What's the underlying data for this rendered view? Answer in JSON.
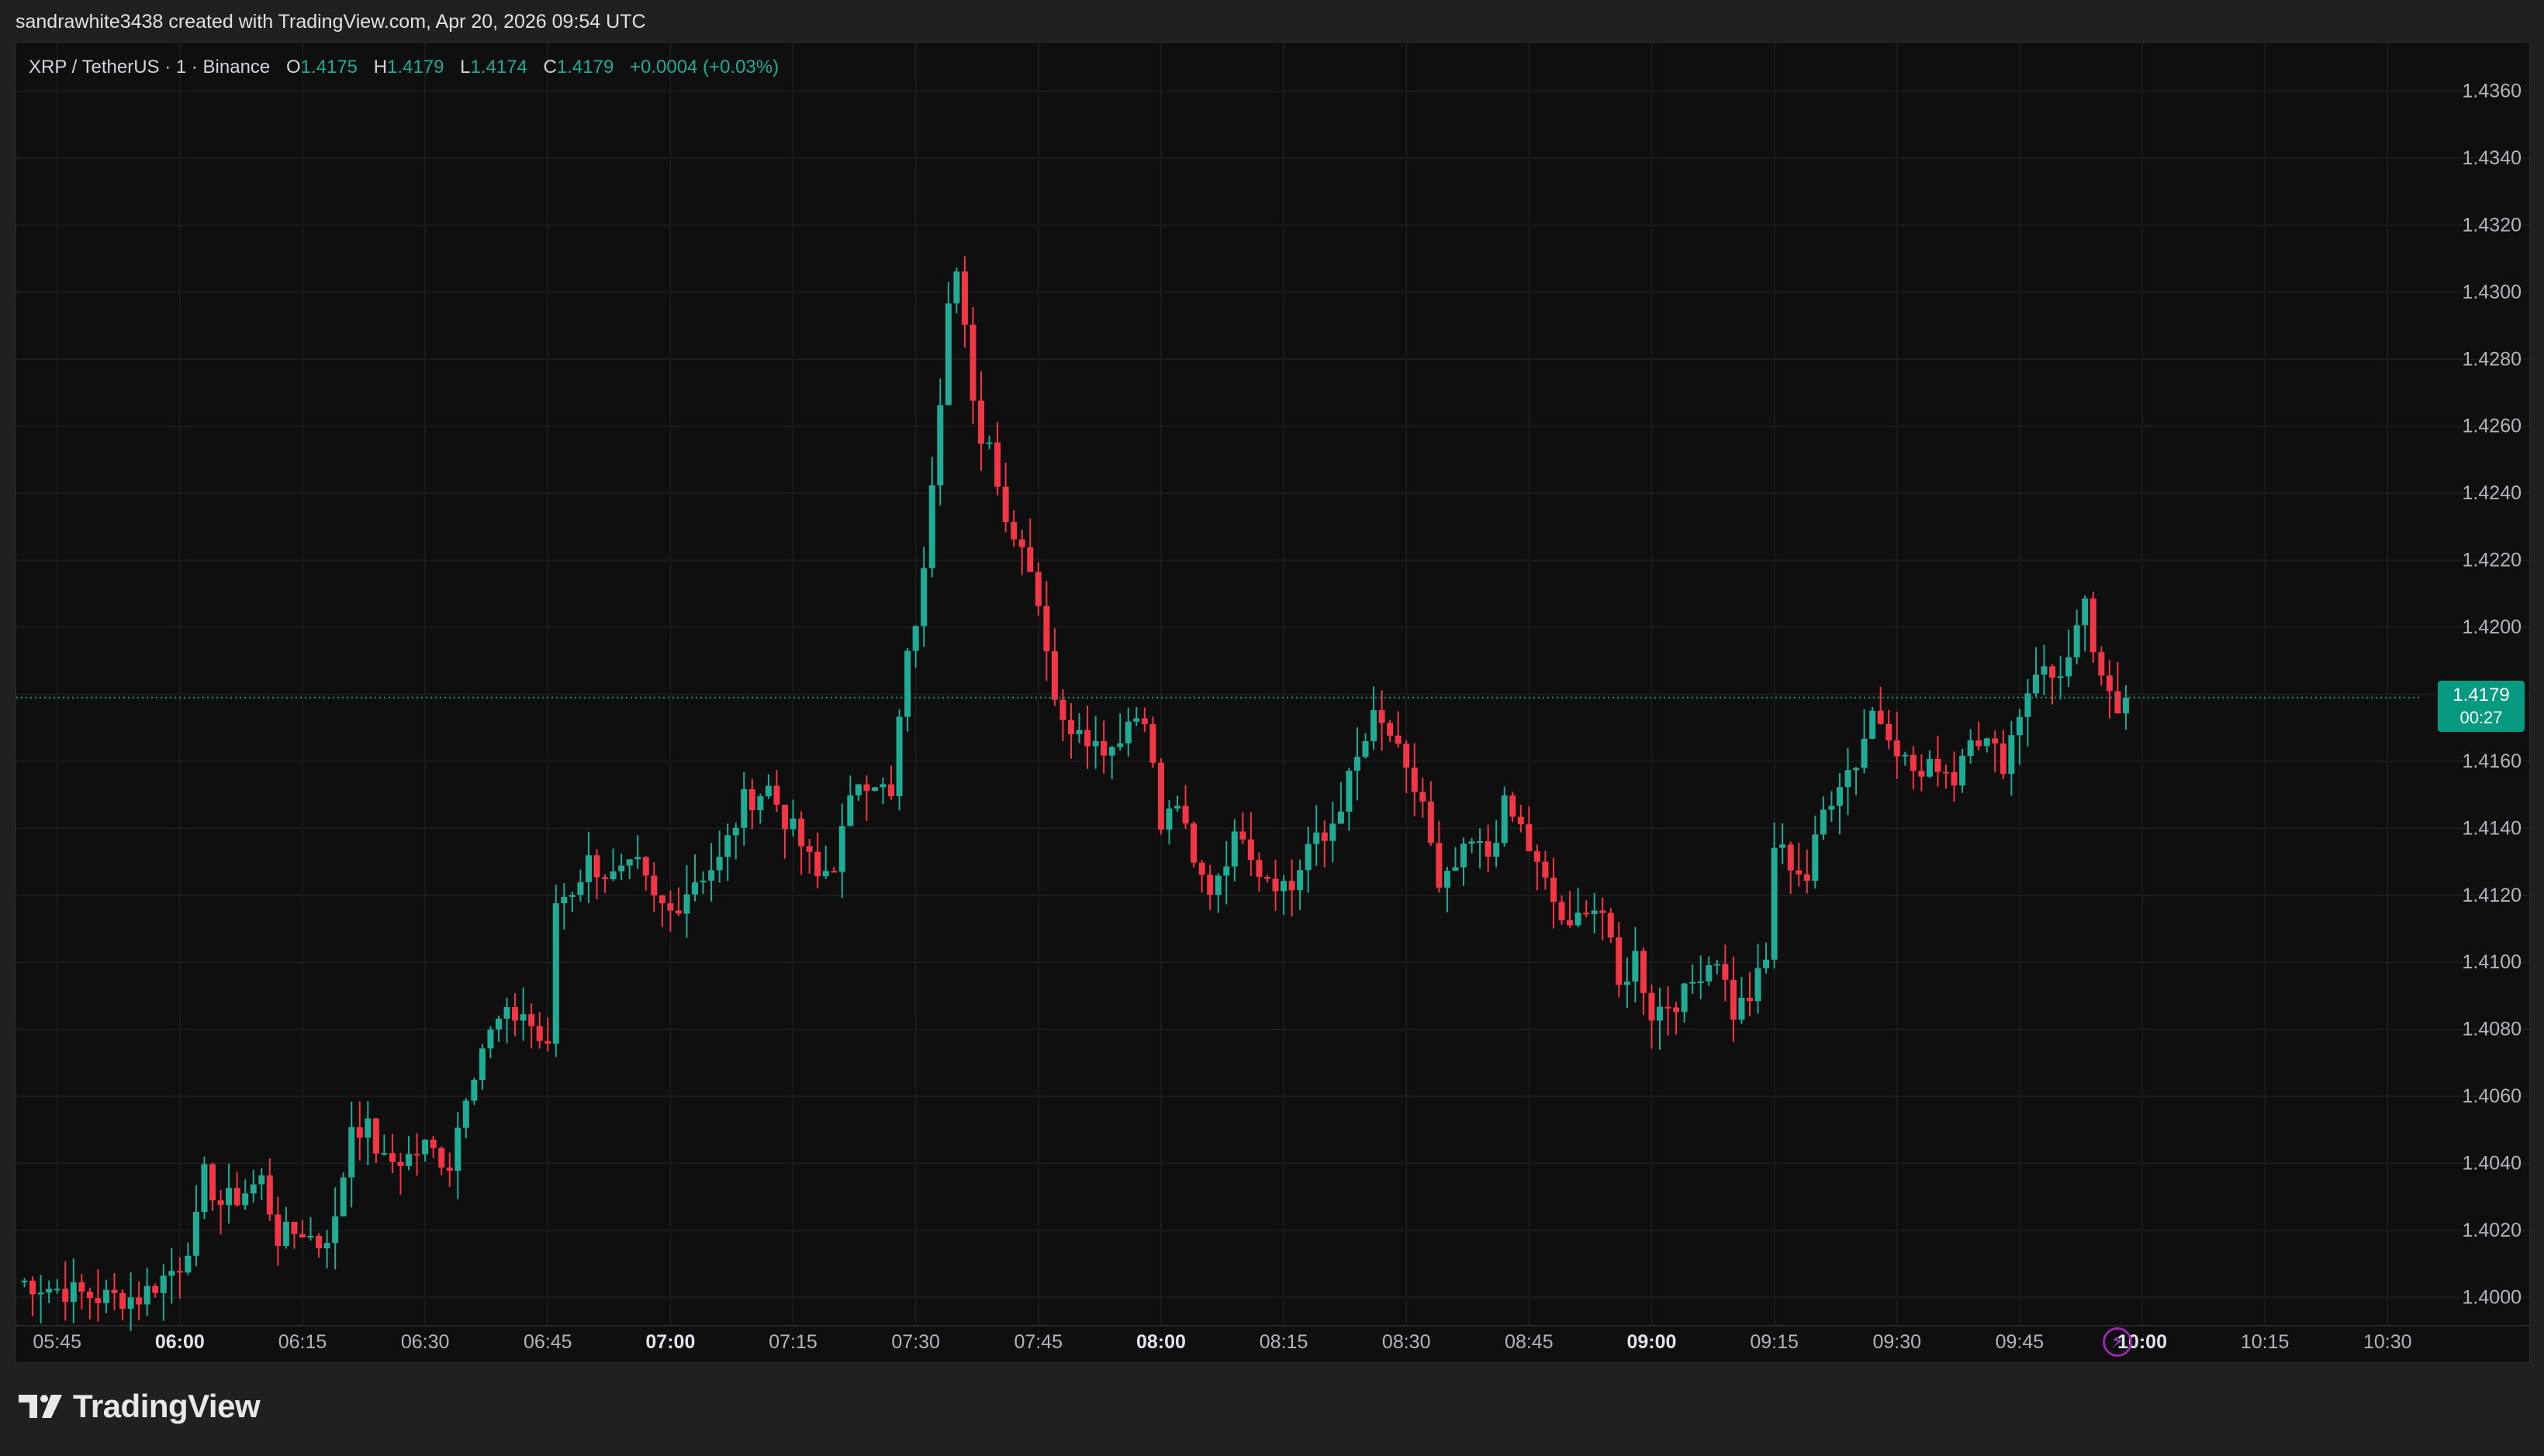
{
  "caption": "sandrawhite3438 created with TradingView.com, Apr 20, 2026 09:54 UTC",
  "legend": {
    "symbol": "XRP / TetherUS · 1 · Binance",
    "o_label": "O",
    "o_value": "1.4175",
    "h_label": "H",
    "h_value": "1.4179",
    "l_label": "L",
    "l_value": "1.4174",
    "c_label": "C",
    "c_value": "1.4179",
    "change": "+0.0004 (+0.03%)"
  },
  "badge": {
    "price": "1.4179",
    "countdown": "00:27"
  },
  "brand": {
    "name": "TradingView"
  },
  "colors": {
    "up": "#22ab94",
    "down": "#f23645",
    "grid": "#1f1f1f",
    "text": "#b2b5be",
    "badge": "#089981",
    "background": "#0f0f0f"
  },
  "icons": {
    "logo": "tradingview-logo-icon",
    "alert": "lightning-icon"
  },
  "chart_data": {
    "type": "candlestick",
    "x_axis_labels": [
      {
        "label": "05:45",
        "bold": false
      },
      {
        "label": "06:00",
        "bold": true
      },
      {
        "label": "06:15",
        "bold": false
      },
      {
        "label": "06:30",
        "bold": false
      },
      {
        "label": "06:45",
        "bold": false
      },
      {
        "label": "07:00",
        "bold": true
      },
      {
        "label": "07:15",
        "bold": false
      },
      {
        "label": "07:30",
        "bold": false
      },
      {
        "label": "07:45",
        "bold": false
      },
      {
        "label": "08:00",
        "bold": true
      },
      {
        "label": "08:15",
        "bold": false
      },
      {
        "label": "08:30",
        "bold": false
      },
      {
        "label": "08:45",
        "bold": false
      },
      {
        "label": "09:00",
        "bold": true
      },
      {
        "label": "09:15",
        "bold": false
      },
      {
        "label": "09:30",
        "bold": false
      },
      {
        "label": "09:45",
        "bold": false
      },
      {
        "label": "10:00",
        "bold": true
      },
      {
        "label": "10:15",
        "bold": false
      },
      {
        "label": "10:30",
        "bold": false
      }
    ],
    "y_axis_labels": [
      "1.4360",
      "1.4340",
      "1.4320",
      "1.4300",
      "1.4280",
      "1.4260",
      "1.4240",
      "1.4220",
      "1.4200",
      "1.4180",
      "1.4160",
      "1.4140",
      "1.4120",
      "1.4100",
      "1.4080",
      "1.4060",
      "1.4040",
      "1.4020",
      "1.4000"
    ],
    "ylim": [
      1.3995,
      1.4368
    ],
    "time_range": [
      "05:40",
      "10:35"
    ],
    "last_price": 1.4179,
    "close_path": [
      [
        "05:40",
        1.4005
      ],
      [
        "05:50",
        1.4
      ],
      [
        "05:55",
        1.4
      ],
      [
        "06:00",
        1.401
      ],
      [
        "06:02",
        1.4022
      ],
      [
        "06:03",
        1.4036
      ],
      [
        "06:05",
        1.4028
      ],
      [
        "06:07",
        1.403
      ],
      [
        "06:10",
        1.4035
      ],
      [
        "06:12",
        1.4018
      ],
      [
        "06:15",
        1.402
      ],
      [
        "06:17",
        1.4016
      ],
      [
        "06:19",
        1.4022
      ],
      [
        "06:21",
        1.4052
      ],
      [
        "06:23",
        1.405
      ],
      [
        "06:25",
        1.404
      ],
      [
        "06:28",
        1.4042
      ],
      [
        "06:30",
        1.4045
      ],
      [
        "06:33",
        1.404
      ],
      [
        "06:35",
        1.4062
      ],
      [
        "06:37",
        1.4075
      ],
      [
        "06:39",
        1.4082
      ],
      [
        "06:42",
        1.4085
      ],
      [
        "06:45",
        1.4073
      ],
      [
        "06:46",
        1.4118
      ],
      [
        "06:48",
        1.4122
      ],
      [
        "06:50",
        1.413
      ],
      [
        "06:53",
        1.4125
      ],
      [
        "06:56",
        1.4128
      ],
      [
        "06:58",
        1.4118
      ],
      [
        "07:00",
        1.4115
      ],
      [
        "07:03",
        1.4125
      ],
      [
        "07:06",
        1.413
      ],
      [
        "07:09",
        1.4148
      ],
      [
        "07:12",
        1.4152
      ],
      [
        "07:14",
        1.4143
      ],
      [
        "07:16",
        1.4135
      ],
      [
        "07:18",
        1.4125
      ],
      [
        "07:20",
        1.413
      ],
      [
        "07:23",
        1.4155
      ],
      [
        "07:25",
        1.4155
      ],
      [
        "07:27",
        1.4148
      ],
      [
        "07:28",
        1.4172
      ],
      [
        "07:29",
        1.419
      ],
      [
        "07:31",
        1.4215
      ],
      [
        "07:32",
        1.4245
      ],
      [
        "07:33",
        1.427
      ],
      [
        "07:34",
        1.43
      ],
      [
        "07:35",
        1.431
      ],
      [
        "07:36",
        1.429
      ],
      [
        "07:37",
        1.4265
      ],
      [
        "07:38",
        1.4252
      ],
      [
        "07:39",
        1.4258
      ],
      [
        "07:40",
        1.4242
      ],
      [
        "07:42",
        1.4228
      ],
      [
        "07:44",
        1.422
      ],
      [
        "07:46",
        1.4195
      ],
      [
        "07:47",
        1.418
      ],
      [
        "07:48",
        1.417
      ],
      [
        "07:50",
        1.4172
      ],
      [
        "07:52",
        1.4165
      ],
      [
        "07:54",
        1.4165
      ],
      [
        "07:56",
        1.4172
      ],
      [
        "07:58",
        1.4175
      ],
      [
        "08:00",
        1.414
      ],
      [
        "08:02",
        1.4148
      ],
      [
        "08:04",
        1.4128
      ],
      [
        "08:06",
        1.4122
      ],
      [
        "08:08",
        1.4132
      ],
      [
        "08:10",
        1.414
      ],
      [
        "08:12",
        1.4128
      ],
      [
        "08:14",
        1.4125
      ],
      [
        "08:16",
        1.4122
      ],
      [
        "08:18",
        1.4135
      ],
      [
        "08:20",
        1.4136
      ],
      [
        "08:22",
        1.4148
      ],
      [
        "08:24",
        1.416
      ],
      [
        "08:26",
        1.4172
      ],
      [
        "08:28",
        1.4168
      ],
      [
        "08:30",
        1.4155
      ],
      [
        "08:32",
        1.4148
      ],
      [
        "08:34",
        1.412
      ],
      [
        "08:36",
        1.4128
      ],
      [
        "08:38",
        1.4135
      ],
      [
        "08:40",
        1.4132
      ],
      [
        "08:42",
        1.4146
      ],
      [
        "08:44",
        1.414
      ],
      [
        "08:46",
        1.4128
      ],
      [
        "08:48",
        1.4118
      ],
      [
        "08:50",
        1.4108
      ],
      [
        "08:52",
        1.4118
      ],
      [
        "08:54",
        1.4115
      ],
      [
        "08:56",
        1.4092
      ],
      [
        "08:58",
        1.4102
      ],
      [
        "09:00",
        1.4085
      ],
      [
        "09:02",
        1.4088
      ],
      [
        "09:04",
        1.409
      ],
      [
        "09:06",
        1.4098
      ],
      [
        "09:08",
        1.4102
      ],
      [
        "09:10",
        1.4085
      ],
      [
        "09:12",
        1.409
      ],
      [
        "09:14",
        1.41
      ],
      [
        "09:15",
        1.4135
      ],
      [
        "09:17",
        1.413
      ],
      [
        "09:19",
        1.4125
      ],
      [
        "09:21",
        1.4145
      ],
      [
        "09:23",
        1.4155
      ],
      [
        "09:25",
        1.416
      ],
      [
        "09:27",
        1.4175
      ],
      [
        "09:29",
        1.417
      ],
      [
        "09:31",
        1.416
      ],
      [
        "09:33",
        1.4155
      ],
      [
        "09:35",
        1.416
      ],
      [
        "09:37",
        1.4155
      ],
      [
        "09:39",
        1.417
      ],
      [
        "09:41",
        1.4165
      ],
      [
        "09:43",
        1.416
      ],
      [
        "09:45",
        1.4175
      ],
      [
        "09:47",
        1.4188
      ],
      [
        "09:49",
        1.4185
      ],
      [
        "09:51",
        1.419
      ],
      [
        "09:53",
        1.4205
      ],
      [
        "09:55",
        1.4182
      ],
      [
        "09:57",
        1.4175
      ],
      [
        "09:58",
        1.4179
      ]
    ]
  }
}
